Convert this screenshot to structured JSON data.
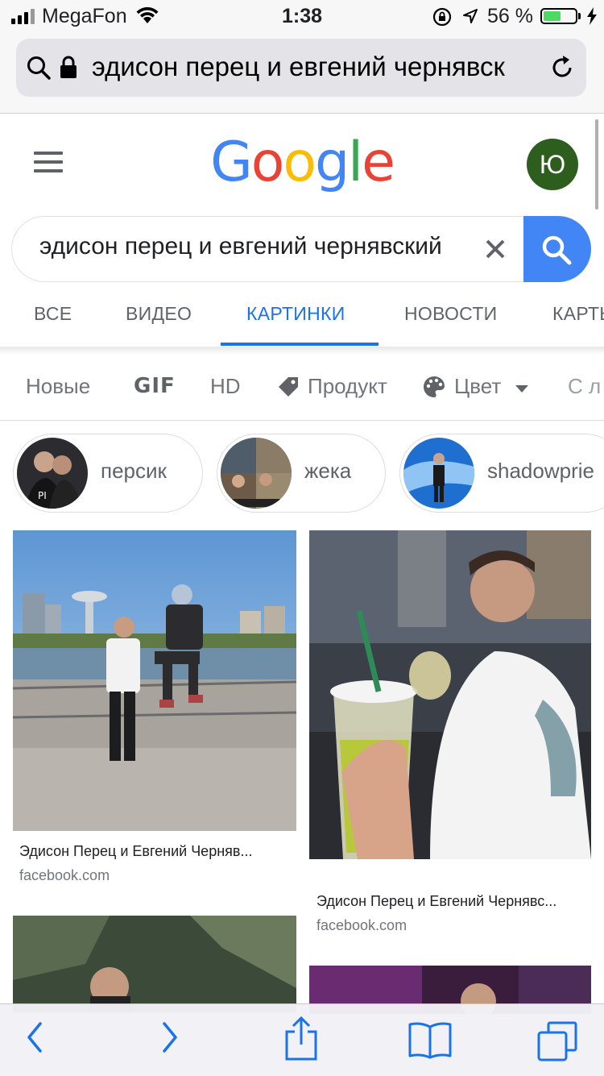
{
  "status_bar": {
    "carrier": "MegaFon",
    "time": "1:38",
    "battery_percent": "56 %",
    "battery_level": 0.56
  },
  "url_bar": {
    "url_text": "эдисон перец и евгений чернявск"
  },
  "header": {
    "logo_letters": [
      {
        "ch": "G",
        "color": "#4285f4"
      },
      {
        "ch": "o",
        "color": "#ea4335"
      },
      {
        "ch": "o",
        "color": "#fbbc05"
      },
      {
        "ch": "g",
        "color": "#4285f4"
      },
      {
        "ch": "l",
        "color": "#34a853"
      },
      {
        "ch": "e",
        "color": "#ea4335"
      }
    ],
    "avatar_letter": "Ю",
    "avatar_color": "#2e5e1e"
  },
  "search": {
    "query": "эдисон перец и евгений чернявский"
  },
  "tabs": [
    {
      "label": "ВСЕ",
      "active": false
    },
    {
      "label": "ВИДЕО",
      "active": false
    },
    {
      "label": "КАРТИНКИ",
      "active": true
    },
    {
      "label": "НОВОСТИ",
      "active": false
    },
    {
      "label": "КАРТЫ",
      "active": false
    }
  ],
  "filters": {
    "new": "Новые",
    "gif": "GIF",
    "hd": "HD",
    "product": "Продукт",
    "color": "Цвет",
    "more": "С л"
  },
  "chips": [
    {
      "label": "персик",
      "icon": "person-thumbnail"
    },
    {
      "label": "жека",
      "icon": "collage-thumbnail"
    },
    {
      "label": "shadowprie",
      "icon": "stage-thumbnail"
    }
  ],
  "results": [
    {
      "title": "Эдисон Перец и Евгений Черняв...",
      "source": "facebook.com"
    },
    {
      "title": "Эдисон Перец и Евгений Чернявс...",
      "source": "facebook.com"
    }
  ],
  "accent_color": "#1a73e8",
  "search_button_color": "#4285f4"
}
